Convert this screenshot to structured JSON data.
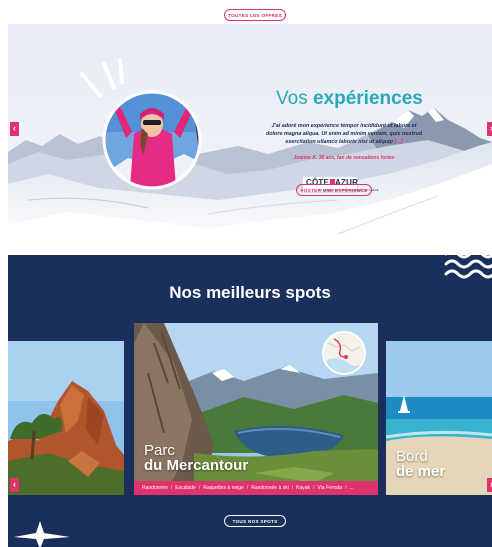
{
  "top": {
    "button_label": "TOUTES LES OFFRES"
  },
  "experiences": {
    "title_light": "Vos",
    "title_bold": "expériences",
    "testimonial": "J'ai adoré mon expérience tempor incididunt ut labore et dolore magna aliqua. Ut enim ad minim veniam, quis nostrud exercitation ullamco laboris nisi ut aliquip",
    "testimonial_more": "[...]",
    "author": "Joanne K. 36 ans, fan de sensations fortes",
    "partner_logo": {
      "name": "CÔTE D'AZUR",
      "word_left": "CÔTE",
      "word_right": "AZUR",
      "tagline": "LA RIVIERA DES MONTAGNES ET DU LARGE"
    },
    "button_label": "POSTER UNE EXPÉRIENCE",
    "prev_label": "‹",
    "next_label": "›"
  },
  "spots": {
    "title_light": "Nos",
    "title_bold": "meilleurs spots",
    "cards": [
      {
        "caption_line1": "",
        "caption_line2": ""
      },
      {
        "caption_line1": "Parc",
        "caption_line2": "du Mercantour",
        "tags": [
          "Randonnée",
          "Escalade",
          "Raquettes à neige",
          "Randonnée à ski",
          "Kayak",
          "Via Ferrata",
          "..."
        ]
      },
      {
        "caption_line1": "Bord",
        "caption_line2": "de mer"
      }
    ],
    "button_label": "TOUS NOS SPOTS",
    "prev_label": "‹",
    "next_label": "›"
  },
  "colors": {
    "accent": "#e0336d",
    "teal": "#2aa8b8",
    "navy": "#1b2f5d"
  },
  "icons": [
    "chevron-left-icon",
    "chevron-right-icon",
    "waves-icon",
    "sparkle-icon",
    "star-icon",
    "map-icon"
  ]
}
